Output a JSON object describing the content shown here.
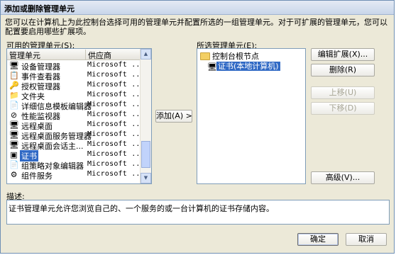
{
  "window": {
    "title": "添加或删除管理单元"
  },
  "intro_text": "您可以在计算机上为此控制台选择可用的管理单元并配置所选的一组管理单元。对于可扩展的管理单元，您可以配置要启用哪些扩展项。",
  "available": {
    "label": "可用的管理单元(S):",
    "columns": [
      "管理单元",
      "供应商"
    ],
    "items": [
      {
        "name": "设备管理器",
        "vendor": "Microsoft ...",
        "icon": "device-manager-icon"
      },
      {
        "name": "事件查看器",
        "vendor": "Microsoft ...",
        "icon": "event-viewer-icon"
      },
      {
        "name": "授权管理器",
        "vendor": "Microsoft ...",
        "icon": "authorization-manager-icon"
      },
      {
        "name": "文件夹",
        "vendor": "Microsoft ...",
        "icon": "folder-icon"
      },
      {
        "name": "详细信息模板编辑器",
        "vendor": "Microsoft ...",
        "icon": "template-editor-icon"
      },
      {
        "name": "性能监视器",
        "vendor": "Microsoft ...",
        "icon": "performance-monitor-icon"
      },
      {
        "name": "远程桌面",
        "vendor": "Microsoft ...",
        "icon": "remote-desktop-icon"
      },
      {
        "name": "远程桌面服务管理器",
        "vendor": "Microsoft ...",
        "icon": "remote-desktop-services-icon"
      },
      {
        "name": "远程桌面会话主...",
        "vendor": "Microsoft ...",
        "icon": "session-host-icon"
      },
      {
        "name": "证书",
        "vendor": "Microsoft ...",
        "icon": "certificate-icon",
        "selected": true
      },
      {
        "name": "组策略对象编辑器",
        "vendor": "Microsoft ...",
        "icon": "group-policy-icon"
      },
      {
        "name": "组件服务",
        "vendor": "Microsoft ...",
        "icon": "component-services-icon"
      }
    ]
  },
  "add_button": "添加(A) >",
  "selected": {
    "label": "所选管理单元(E):",
    "root": "控制台根节点",
    "child": "证书(本地计算机)"
  },
  "buttons": {
    "edit_extensions": "编辑扩展(X)...",
    "remove": "删除(R)",
    "move_up": "上移(U)",
    "move_down": "下移(D)",
    "advanced": "高级(V)...",
    "ok": "确定",
    "cancel": "取消"
  },
  "description": {
    "label": "描述:",
    "text": "证书管理单元允许您浏览自己的、一个服务的或一台计算机的证书存储内容。"
  }
}
